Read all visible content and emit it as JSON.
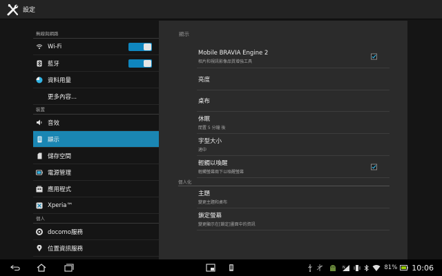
{
  "app": {
    "title": "設定",
    "icon": "settings-tools-icon"
  },
  "left": {
    "sections": [
      {
        "header": "無線與網路",
        "items": [
          {
            "label": "Wi-Fi",
            "icon": "wifi-icon",
            "toggle": true
          },
          {
            "label": "藍牙",
            "icon": "bluetooth-icon",
            "toggle": true
          },
          {
            "label": "資料用量",
            "icon": "data-usage-icon"
          },
          {
            "label": "更多內容...",
            "icon": ""
          }
        ]
      },
      {
        "header": "裝置",
        "items": [
          {
            "label": "音效",
            "icon": "sound-icon"
          },
          {
            "label": "顯示",
            "icon": "display-icon",
            "selected": true
          },
          {
            "label": "儲存空間",
            "icon": "storage-icon"
          },
          {
            "label": "電源管理",
            "icon": "battery-icon"
          },
          {
            "label": "應用程式",
            "icon": "apps-icon"
          },
          {
            "label": "Xperia™",
            "icon": "xperia-icon"
          }
        ]
      },
      {
        "header": "個人",
        "items": [
          {
            "label": "docomo服務",
            "icon": "docomo-icon"
          },
          {
            "label": "位置資訊服務",
            "icon": "location-icon"
          }
        ]
      }
    ]
  },
  "right": {
    "header": "顯示",
    "items": [
      {
        "title": "Mobile BRAVIA Engine 2",
        "subtitle": "相片和視訊影像品質增強工具",
        "checkbox": true,
        "checked": true
      },
      {
        "title": "亮度",
        "subtitle": ""
      },
      {
        "title": "桌布",
        "subtitle": ""
      },
      {
        "title": "休眠",
        "subtitle": "閒置 5 分鐘 後"
      },
      {
        "title": "字型大小",
        "subtitle": "適中"
      },
      {
        "title": "輕觸以喚醒",
        "subtitle": "輕觸螢幕兩下以喚醒螢幕",
        "checkbox": true,
        "checked": true
      },
      {
        "category": "個人化"
      },
      {
        "title": "主題",
        "subtitle": "變更主題和桌布"
      },
      {
        "title": "鎖定螢幕",
        "subtitle": "變更顯示在[鎖定]畫面中的資訊"
      }
    ]
  },
  "statusbar": {
    "battery": "81%",
    "time": "10:06"
  },
  "colors": {
    "accent": "#1a86b3",
    "toggle": "#0f86bf",
    "check": "#33b5e5"
  }
}
